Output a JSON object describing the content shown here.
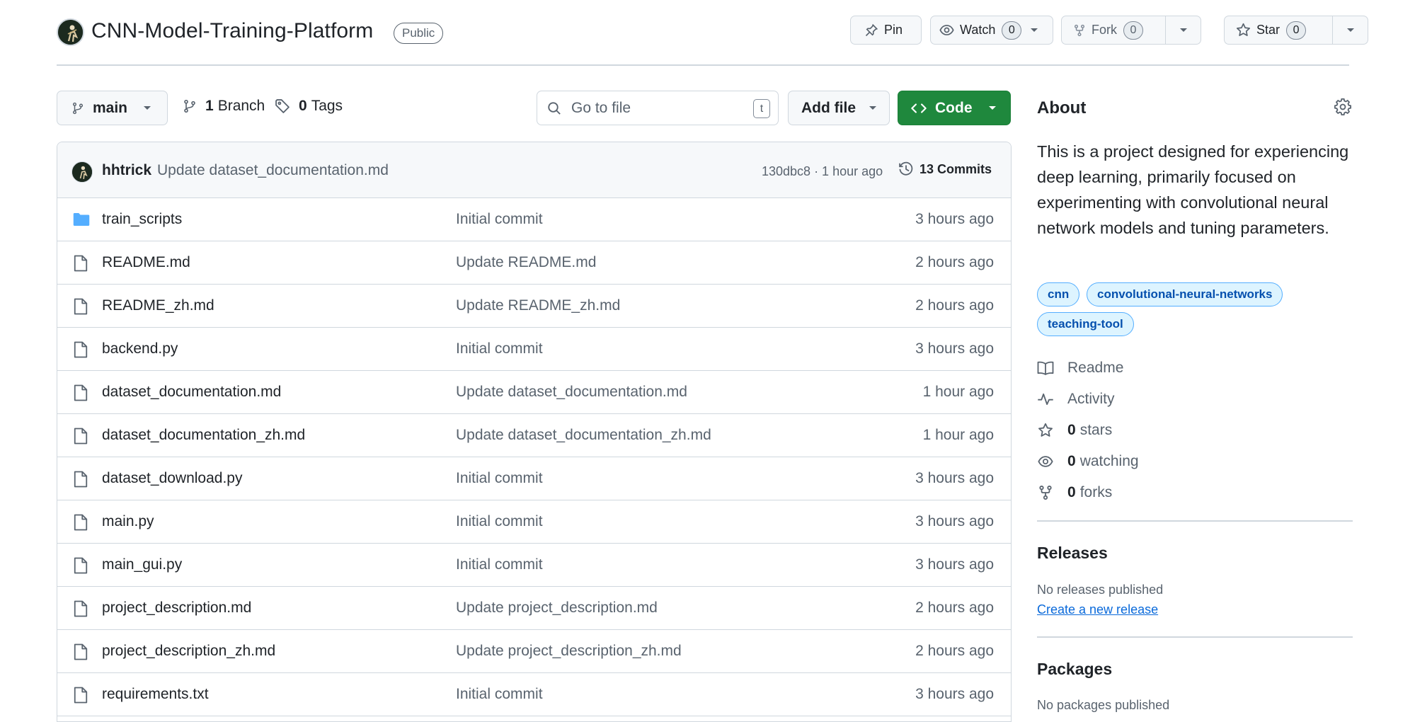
{
  "repo": {
    "name": "CNN-Model-Training-Platform",
    "visibility": "Public"
  },
  "header_actions": {
    "pin_label": "Pin",
    "watch_label": "Watch",
    "watch_count": "0",
    "fork_label": "Fork",
    "fork_count": "0",
    "star_label": "Star",
    "star_count": "0"
  },
  "toolbar": {
    "branch": "main",
    "branches_count": "1",
    "branches_label": "Branch",
    "tags_count": "0",
    "tags_label": "Tags",
    "search_placeholder": "Go to file",
    "search_shortcut": "t",
    "add_file_label": "Add file",
    "code_label": "Code"
  },
  "latest_commit": {
    "author": "hhtrick",
    "message": "Update dataset_documentation.md",
    "meta": "130dbc8 · 1 hour ago",
    "commits_label": "13 Commits"
  },
  "files": [
    {
      "name": "train_scripts",
      "type": "folder",
      "message": "Initial commit",
      "age": "3 hours ago"
    },
    {
      "name": "README.md",
      "type": "file",
      "message": "Update README.md",
      "age": "2 hours ago"
    },
    {
      "name": "README_zh.md",
      "type": "file",
      "message": "Update README_zh.md",
      "age": "2 hours ago"
    },
    {
      "name": "backend.py",
      "type": "file",
      "message": "Initial commit",
      "age": "3 hours ago"
    },
    {
      "name": "dataset_documentation.md",
      "type": "file",
      "message": "Update dataset_documentation.md",
      "age": "1 hour ago"
    },
    {
      "name": "dataset_documentation_zh.md",
      "type": "file",
      "message": "Update dataset_documentation_zh.md",
      "age": "1 hour ago"
    },
    {
      "name": "dataset_download.py",
      "type": "file",
      "message": "Initial commit",
      "age": "3 hours ago"
    },
    {
      "name": "main.py",
      "type": "file",
      "message": "Initial commit",
      "age": "3 hours ago"
    },
    {
      "name": "main_gui.py",
      "type": "file",
      "message": "Initial commit",
      "age": "3 hours ago"
    },
    {
      "name": "project_description.md",
      "type": "file",
      "message": "Update project_description.md",
      "age": "2 hours ago"
    },
    {
      "name": "project_description_zh.md",
      "type": "file",
      "message": "Update project_description_zh.md",
      "age": "2 hours ago"
    },
    {
      "name": "requirements.txt",
      "type": "file",
      "message": "Initial commit",
      "age": "3 hours ago"
    }
  ],
  "about": {
    "title": "About",
    "description": "This is a project designed for experiencing deep learning, primarily focused on experimenting with convolutional neural network models and tuning parameters.",
    "topics": [
      "cnn",
      "convolutional-neural-networks",
      "teaching-tool"
    ],
    "readme_label": "Readme",
    "activity_label": "Activity",
    "stars_count": "0",
    "stars_label": "stars",
    "watching_count": "0",
    "watching_label": "watching",
    "forks_count": "0",
    "forks_label": "forks"
  },
  "releases": {
    "title": "Releases",
    "note": "No releases published",
    "link": "Create a new release"
  },
  "packages": {
    "title": "Packages",
    "note": "No packages published"
  },
  "colors": {
    "accent_link": "#0969da",
    "code_button": "#1f883d",
    "folder_icon": "#54aeff",
    "border": "#d0d7de",
    "muted_text": "#59636e"
  }
}
